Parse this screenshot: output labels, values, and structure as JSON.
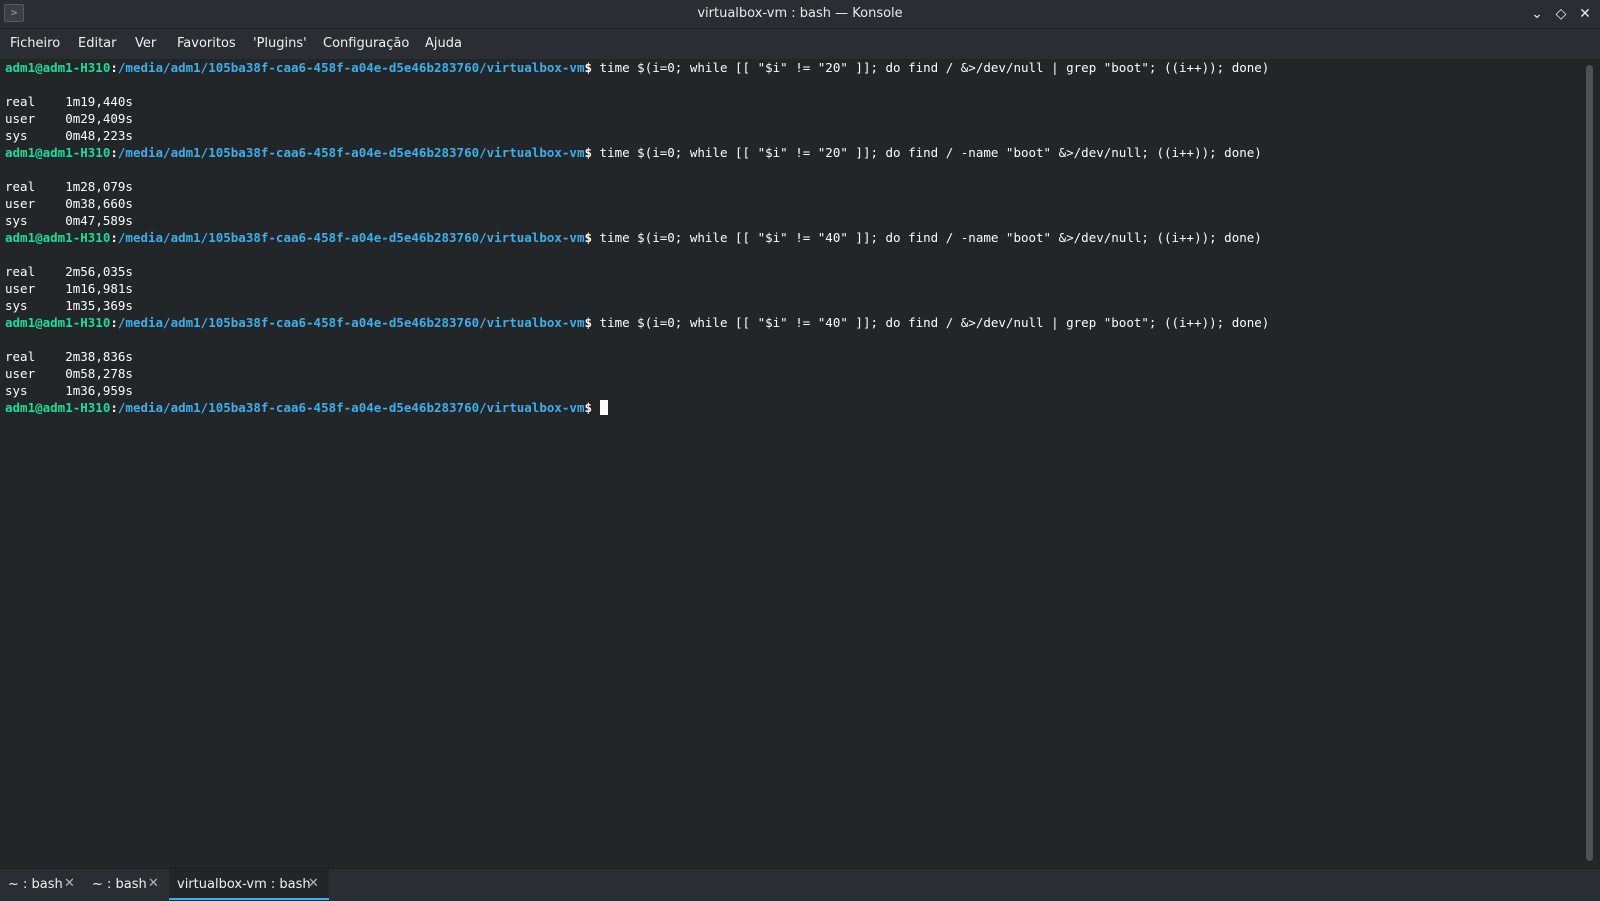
{
  "window": {
    "title": "virtualbox-vm : bash — Konsole",
    "app_icon": "terminal-icon",
    "controls": {
      "minimize": "⌄",
      "maximize": "◇",
      "close": "✕"
    }
  },
  "menubar": {
    "items": [
      "Ficheiro",
      "Editar",
      "Ver",
      "Favoritos",
      "'Plugins'",
      "Configuração",
      "Ajuda"
    ]
  },
  "terminal": {
    "prompt_user": "adm1@adm1-H310",
    "prompt_sep": ":",
    "prompt_path": "/media/adm1/105ba38f-caa6-458f-a04e-d5e46b283760/virtualbox-vm",
    "prompt_symbol": "$",
    "commands": [
      " time $(i=0; while [[ \"$i\" != \"20\" ]]; do find / &>/dev/null | grep \"boot\"; ((i++)); done)",
      " time $(i=0; while [[ \"$i\" != \"20\" ]]; do find / -name \"boot\" &>/dev/null; ((i++)); done)",
      " time $(i=0; while [[ \"$i\" != \"40\" ]]; do find / -name \"boot\" &>/dev/null; ((i++)); done)",
      " time $(i=0; while [[ \"$i\" != \"40\" ]]; do find / &>/dev/null | grep \"boot\"; ((i++)); done)"
    ],
    "outputs": [
      [
        "real\t1m19,440s",
        "user\t0m29,409s",
        "sys\t0m48,223s"
      ],
      [
        "real\t1m28,079s",
        "user\t0m38,660s",
        "sys\t0m47,589s"
      ],
      [
        "real\t2m56,035s",
        "user\t1m16,981s",
        "sys\t1m35,369s"
      ],
      [
        "real\t2m38,836s",
        "user\t0m58,278s",
        "sys\t1m36,959s"
      ]
    ]
  },
  "tabs": [
    {
      "label": "~ : bash",
      "close": "✕",
      "active": false
    },
    {
      "label": "~ : bash",
      "close": "✕",
      "active": false
    },
    {
      "label": "virtualbox-vm : bash",
      "close": "✕",
      "active": true
    }
  ]
}
